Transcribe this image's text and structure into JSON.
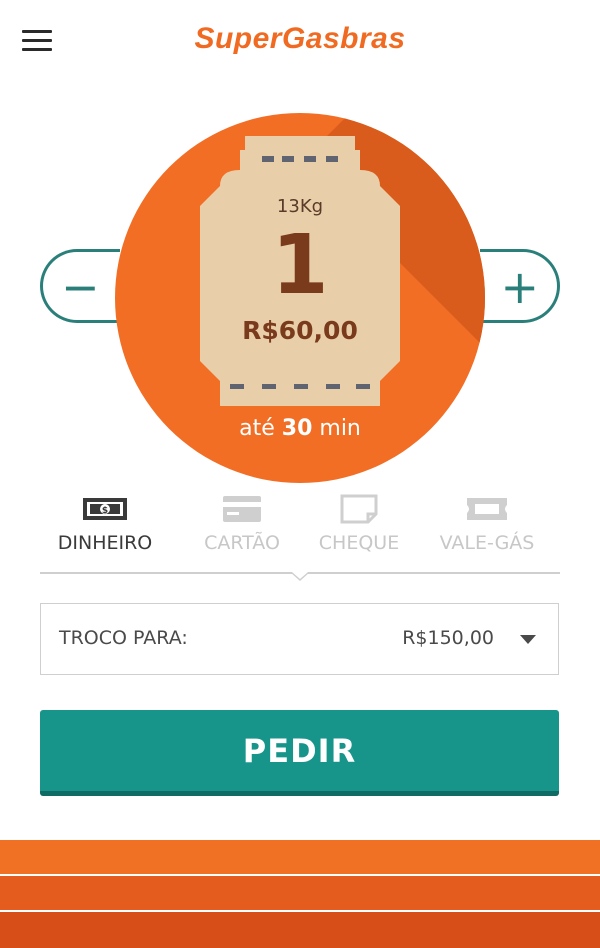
{
  "header": {
    "logo_text": "SuperGasbras",
    "menu_icon": "hamburger-menu-icon"
  },
  "order": {
    "weight": "13Kg",
    "quantity": "1",
    "price": "R$60,00",
    "eta_prefix": "até",
    "eta_value": "30",
    "eta_unit": "min",
    "decrement_glyph": "−",
    "increment_glyph": "+"
  },
  "payment": {
    "tabs": [
      {
        "label": "DINHEIRO",
        "icon": "cash-icon",
        "active": true
      },
      {
        "label": "CARTÃO",
        "icon": "credit-card-icon",
        "active": false
      },
      {
        "label": "CHEQUE",
        "icon": "check-icon",
        "active": false
      },
      {
        "label": "VALE-GÁS",
        "icon": "voucher-icon",
        "active": false
      }
    ]
  },
  "troco": {
    "label": "TROCO PARA:",
    "value": "R$150,00"
  },
  "actions": {
    "submit_label": "PEDIR"
  },
  "colors": {
    "brand_orange": "#f26e25",
    "teal": "#17958b",
    "outline_teal": "#2b7f7a",
    "tank_beige": "#e9cfa9"
  }
}
